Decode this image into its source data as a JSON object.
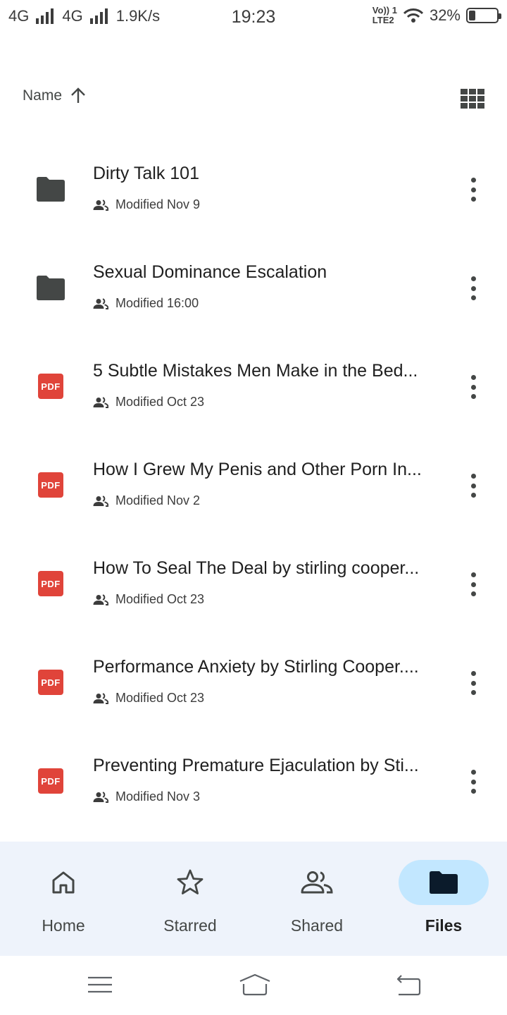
{
  "status_bar": {
    "net1": "4G",
    "net2": "4G",
    "speed": "1.9K/s",
    "time": "19:23",
    "volte_line1": "Vo)) 1",
    "volte_line2": "LTE2",
    "battery_pct": "32%",
    "battery_level": 0.32
  },
  "sort": {
    "label": "Name",
    "direction_icon": "arrow-up-icon",
    "view_icon": "grid-view-icon"
  },
  "files": [
    {
      "type": "folder",
      "title": "Dirty Talk 101",
      "meta": "Modified Nov 9"
    },
    {
      "type": "folder",
      "title": "Sexual Dominance Escalation",
      "meta": "Modified 16:00"
    },
    {
      "type": "pdf",
      "title": "5 Subtle Mistakes Men Make in the Bed...",
      "meta": "Modified Oct 23"
    },
    {
      "type": "pdf",
      "title": "How I Grew My Penis and Other Porn In...",
      "meta": "Modified Nov 2"
    },
    {
      "type": "pdf",
      "title": "How To Seal The Deal by stirling cooper...",
      "meta": "Modified Oct 23"
    },
    {
      "type": "pdf",
      "title": "Performance Anxiety by Stirling Cooper....",
      "meta": "Modified Oct 23"
    },
    {
      "type": "pdf",
      "title": "Preventing Premature Ejaculation by Sti...",
      "meta": "Modified Nov 3"
    }
  ],
  "pdf_badge": "PDF",
  "bottom_nav": {
    "items": [
      {
        "label": "Home",
        "icon": "home-icon"
      },
      {
        "label": "Starred",
        "icon": "star-icon"
      },
      {
        "label": "Shared",
        "icon": "people-icon"
      },
      {
        "label": "Files",
        "icon": "folder-icon",
        "active": true
      }
    ]
  },
  "colors": {
    "pdf_red": "#e0443a",
    "nav_bg": "#eef3fb",
    "active_pill": "#c2e7ff"
  }
}
